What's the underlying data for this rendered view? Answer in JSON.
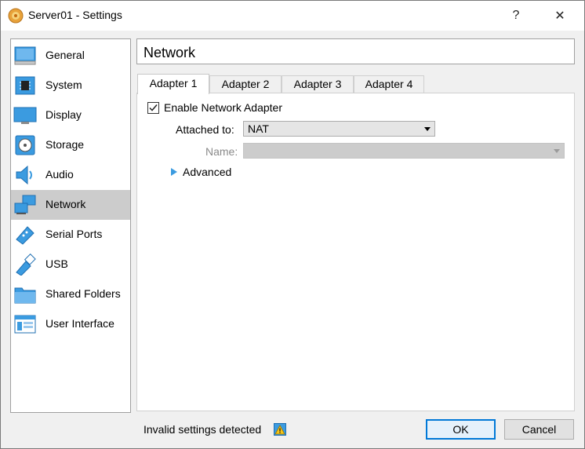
{
  "window": {
    "title": "Server01 - Settings",
    "help_label": "?",
    "close_label": "✕"
  },
  "sidebar": {
    "items": [
      {
        "label": "General",
        "icon": "general-icon"
      },
      {
        "label": "System",
        "icon": "system-chip-icon"
      },
      {
        "label": "Display",
        "icon": "display-monitor-icon"
      },
      {
        "label": "Storage",
        "icon": "storage-disk-icon"
      },
      {
        "label": "Audio",
        "icon": "audio-speaker-icon"
      },
      {
        "label": "Network",
        "icon": "network-icon",
        "selected": true
      },
      {
        "label": "Serial Ports",
        "icon": "serial-port-icon"
      },
      {
        "label": "USB",
        "icon": "usb-icon"
      },
      {
        "label": "Shared Folders",
        "icon": "shared-folder-icon"
      },
      {
        "label": "User Interface",
        "icon": "user-interface-icon"
      }
    ]
  },
  "main": {
    "section_title": "Network",
    "tabs": [
      {
        "label": "Adapter 1",
        "active": true
      },
      {
        "label": "Adapter 2"
      },
      {
        "label": "Adapter 3"
      },
      {
        "label": "Adapter 4"
      }
    ],
    "enable_label": "Enable Network Adapter",
    "enable_checked": true,
    "attached_label": "Attached to:",
    "attached_value": "NAT",
    "name_label": "Name:",
    "name_value": "",
    "advanced_label": "Advanced"
  },
  "footer": {
    "status": "Invalid settings detected",
    "ok_label": "OK",
    "cancel_label": "Cancel"
  },
  "colors": {
    "accent": "#0078d7",
    "selected_bg": "#cccccc",
    "icon_blue": "#3b9be0"
  }
}
